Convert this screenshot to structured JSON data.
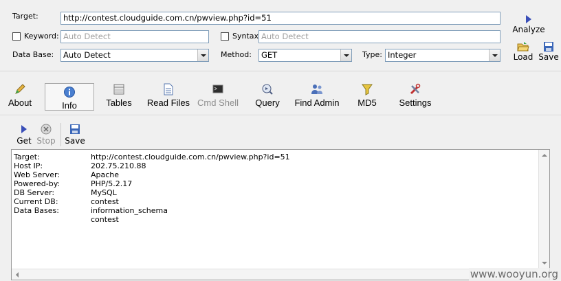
{
  "form": {
    "target_label": "Target:",
    "target_value": "http://contest.cloudguide.com.cn/pwview.php?id=51",
    "keyword_label": "Keyword:",
    "keyword_placeholder": "Auto Detect",
    "syntax_label": "Syntax:",
    "syntax_placeholder": "Auto Detect",
    "database_label": "Data Base:",
    "database_value": "Auto Detect",
    "method_label": "Method:",
    "method_value": "GET",
    "type_label": "Type:",
    "type_value": "Integer"
  },
  "actions": {
    "analyze": "Analyze",
    "load": "Load",
    "save": "Save"
  },
  "tabs": [
    {
      "label": "About"
    },
    {
      "label": "Info"
    },
    {
      "label": "Tables"
    },
    {
      "label": "Read Files"
    },
    {
      "label": "Cmd Shell"
    },
    {
      "label": "Query"
    },
    {
      "label": "Find Admin"
    },
    {
      "label": "MD5"
    },
    {
      "label": "Settings"
    }
  ],
  "subtoolbar": {
    "get": "Get",
    "stop": "Stop",
    "save": "Save"
  },
  "output": {
    "rows": [
      {
        "key": "Target:",
        "value": "http://contest.cloudguide.com.cn/pwview.php?id=51"
      },
      {
        "key": "Host IP:",
        "value": "202.75.210.88"
      },
      {
        "key": "Web Server:",
        "value": "Apache"
      },
      {
        "key": "Powered-by:",
        "value": "PHP/5.2.17"
      },
      {
        "key": "DB Server:",
        "value": "MySQL"
      },
      {
        "key": "Current DB:",
        "value": "contest"
      },
      {
        "key": "Data Bases:",
        "value": "information_schema"
      },
      {
        "key": "",
        "value": "contest"
      }
    ]
  },
  "watermark": "www.wooyun.org",
  "colors": {
    "window_bg": "#f0f0f0",
    "field_border": "#7f9db9",
    "placeholder": "#a0a0a0",
    "play_icon": "#3a4fb8"
  }
}
